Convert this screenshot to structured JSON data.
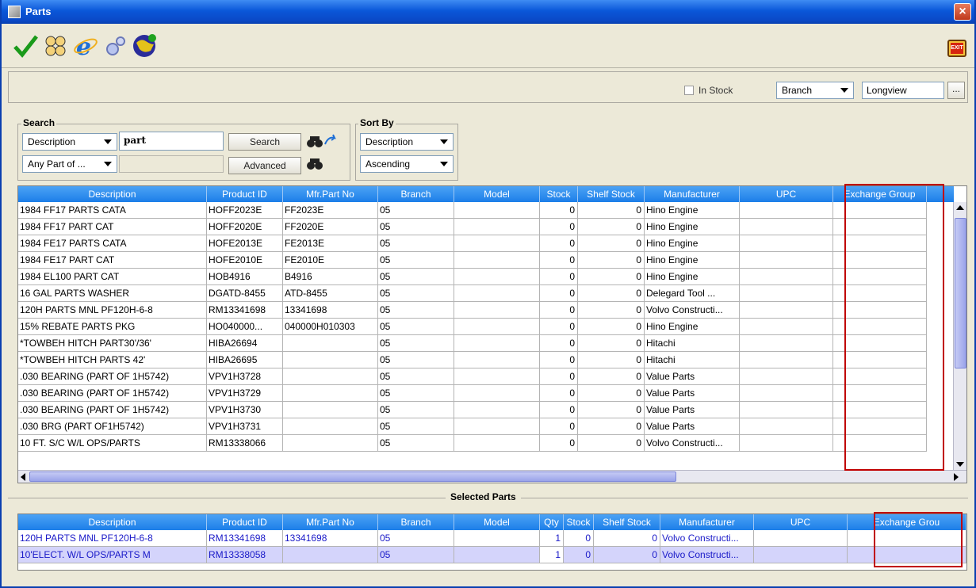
{
  "window": {
    "title": "Parts"
  },
  "toolbar": {
    "icons": [
      "checkmark-icon",
      "people-icon",
      "browser-icon",
      "gears-icon",
      "globe-icon"
    ],
    "exit_label": "EXIT"
  },
  "filter_bar": {
    "in_stock_label": "In Stock",
    "in_stock_checked": false,
    "scope_value": "Branch",
    "location_value": "Longview",
    "browse_label": "..."
  },
  "search": {
    "group_label": "Search",
    "field_value": "Description",
    "query_value": "part",
    "match_value": "Any Part of ...",
    "search_label": "Search",
    "advanced_label": "Advanced"
  },
  "sort": {
    "group_label": "Sort By",
    "field_value": "Description",
    "order_value": "Ascending"
  },
  "results": {
    "columns": [
      "Description",
      "Product ID",
      "Mfr.Part No",
      "Branch",
      "Model",
      "Stock",
      "Shelf Stock",
      "Manufacturer",
      "UPC",
      "Exchange Group"
    ],
    "rows": [
      [
        "1984 FF17 PARTS CATA",
        "HOFF2023E",
        "FF2023E",
        "05",
        "",
        "0",
        "0",
        "Hino Engine",
        "",
        ""
      ],
      [
        "1984 FF17 PART CAT",
        "HOFF2020E",
        "FF2020E",
        "05",
        "",
        "0",
        "0",
        "Hino Engine",
        "",
        ""
      ],
      [
        "1984 FE17 PARTS CATA",
        "HOFE2013E",
        "FE2013E",
        "05",
        "",
        "0",
        "0",
        "Hino Engine",
        "",
        ""
      ],
      [
        "1984 FE17 PART CAT",
        "HOFE2010E",
        "FE2010E",
        "05",
        "",
        "0",
        "0",
        "Hino Engine",
        "",
        ""
      ],
      [
        "1984 EL100 PART CAT",
        "HOB4916",
        "B4916",
        "05",
        "",
        "0",
        "0",
        "Hino Engine",
        "",
        ""
      ],
      [
        "16 GAL PARTS WASHER",
        "DGATD-8455",
        "ATD-8455",
        "05",
        "",
        "0",
        "0",
        "Delegard Tool ...",
        "",
        ""
      ],
      [
        "120H PARTS MNL PF120H-6-8",
        "RM13341698",
        "13341698",
        "05",
        "",
        "0",
        "0",
        "Volvo Constructi...",
        "",
        ""
      ],
      [
        "15% REBATE PARTS PKG",
        "HO040000...",
        "040000H010303",
        "05",
        "",
        "0",
        "0",
        "Hino Engine",
        "",
        ""
      ],
      [
        "*TOWBEH HITCH PART30'/36'",
        "HIBA26694",
        "",
        "05",
        "",
        "0",
        "0",
        "Hitachi",
        "",
        ""
      ],
      [
        "*TOWBEH HITCH PARTS 42'",
        "HIBA26695",
        "",
        "05",
        "",
        "0",
        "0",
        "Hitachi",
        "",
        ""
      ],
      [
        ".030 BEARING (PART OF 1H5742)",
        "VPV1H3728",
        "",
        "05",
        "",
        "0",
        "0",
        "Value Parts",
        "",
        ""
      ],
      [
        ".030 BEARING (PART OF 1H5742)",
        "VPV1H3729",
        "",
        "05",
        "",
        "0",
        "0",
        "Value Parts",
        "",
        ""
      ],
      [
        ".030 BEARING (PART OF 1H5742)",
        "VPV1H3730",
        "",
        "05",
        "",
        "0",
        "0",
        "Value Parts",
        "",
        ""
      ],
      [
        ".030 BRG (PART OF1H5742)",
        "VPV1H3731",
        "",
        "05",
        "",
        "0",
        "0",
        "Value Parts",
        "",
        ""
      ],
      [
        "10 FT. S/C W/L OPS/PARTS",
        "RM13338066",
        "",
        "05",
        "",
        "0",
        "0",
        "Volvo Constructi...",
        "",
        ""
      ]
    ]
  },
  "selected": {
    "label": "Selected Parts",
    "columns": [
      "Description",
      "Product ID",
      "Mfr.Part No",
      "Branch",
      "Model",
      "Qty",
      "Stock",
      "Shelf Stock",
      "Manufacturer",
      "UPC",
      "Exchange Grou"
    ],
    "rows": [
      [
        "120H PARTS MNL PF120H-6-8",
        "RM13341698",
        "13341698",
        "05",
        "",
        "1",
        "0",
        "0",
        "Volvo Constructi...",
        "",
        ""
      ],
      [
        "10'ELECT. W/L OPS/PARTS M",
        "RM13338058",
        "",
        "05",
        "",
        "1",
        "0",
        "0",
        "Volvo Constructi...",
        "",
        ""
      ]
    ]
  },
  "colors": {
    "header": "#1c7ee8",
    "highlight": "#c00000",
    "selected_text": "#1919c8",
    "selected_row_bg": "#d4d4fb"
  }
}
